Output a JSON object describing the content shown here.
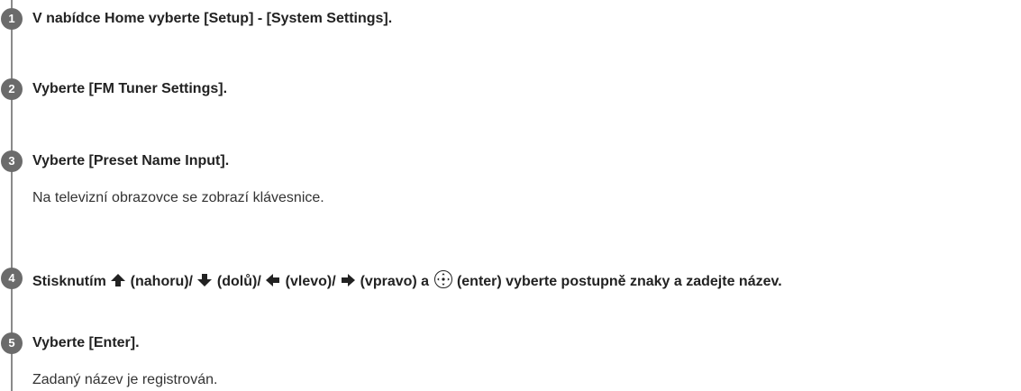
{
  "steps": [
    {
      "number": "1",
      "title": "V nabídce Home vyberte [Setup] - [System Settings]."
    },
    {
      "number": "2",
      "title": "Vyberte [FM Tuner Settings]."
    },
    {
      "number": "3",
      "title": "Vyberte [Preset Name Input].",
      "description": "Na televizní obrazovce se zobrazí klávesnice."
    },
    {
      "number": "4",
      "title_parts": {
        "prefix": "Stisknutím ",
        "up": " (nahoru)/",
        "down": " (dolů)/",
        "left": " (vlevo)/",
        "right": " (vpravo) a ",
        "enter": " (enter) vyberte postupně znaky a zadejte název."
      },
      "icons": [
        "arrow-up-icon",
        "arrow-down-icon",
        "arrow-left-icon",
        "arrow-right-icon",
        "enter-icon"
      ]
    },
    {
      "number": "5",
      "title": "Vyberte [Enter].",
      "description": "Zadaný název je registrován."
    }
  ],
  "colors": {
    "step_circle": "#6b6b6b",
    "timeline": "#8a8a8a",
    "text": "#222222"
  }
}
